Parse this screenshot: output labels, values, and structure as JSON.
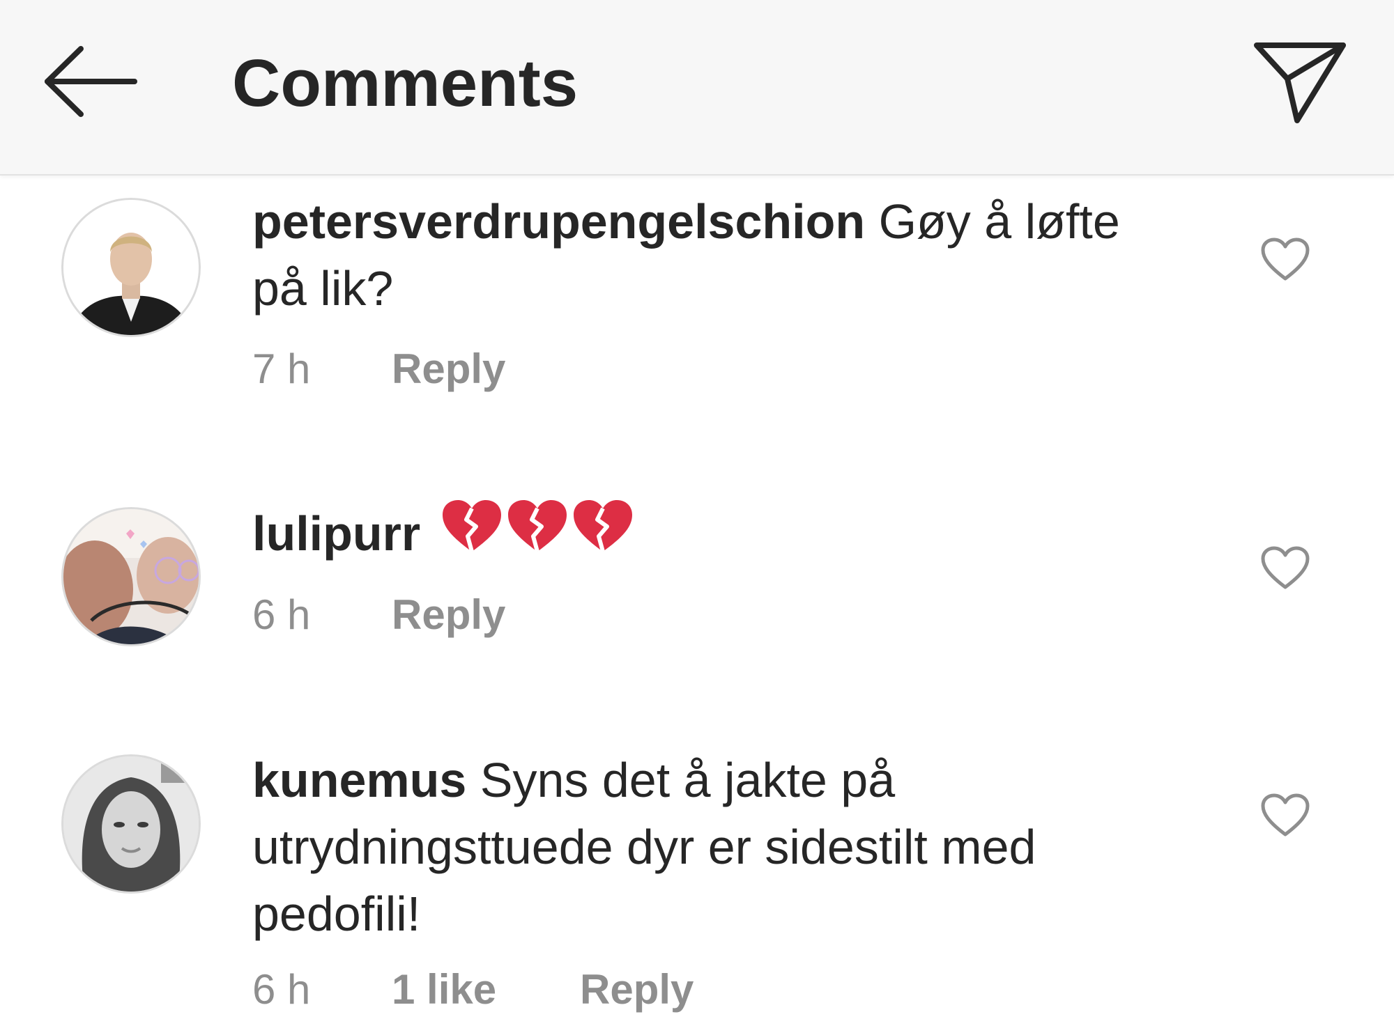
{
  "header": {
    "title": "Comments",
    "back_icon": "arrow-left-icon",
    "send_icon": "paper-plane-icon"
  },
  "colors": {
    "text": "#262626",
    "secondary": "#8e8e8e",
    "header_bg": "#f7f7f7",
    "broken_heart": "#dd2e44"
  },
  "comments": [
    {
      "username": "petersverdrupengelschion",
      "text": "Gøy å løfte på lik?",
      "time": "7 h",
      "reply_label": "Reply"
    },
    {
      "username": "lulipurr",
      "text": "",
      "emoji": [
        "broken-heart-icon",
        "broken-heart-icon",
        "broken-heart-icon"
      ],
      "time": "6 h",
      "reply_label": "Reply"
    },
    {
      "username": "kunemus",
      "text": "Syns det å jakte på utrydningsttuede dyr er sidestilt med pedofili!",
      "time": "6 h",
      "likes": "1 like",
      "reply_label": "Reply"
    }
  ]
}
